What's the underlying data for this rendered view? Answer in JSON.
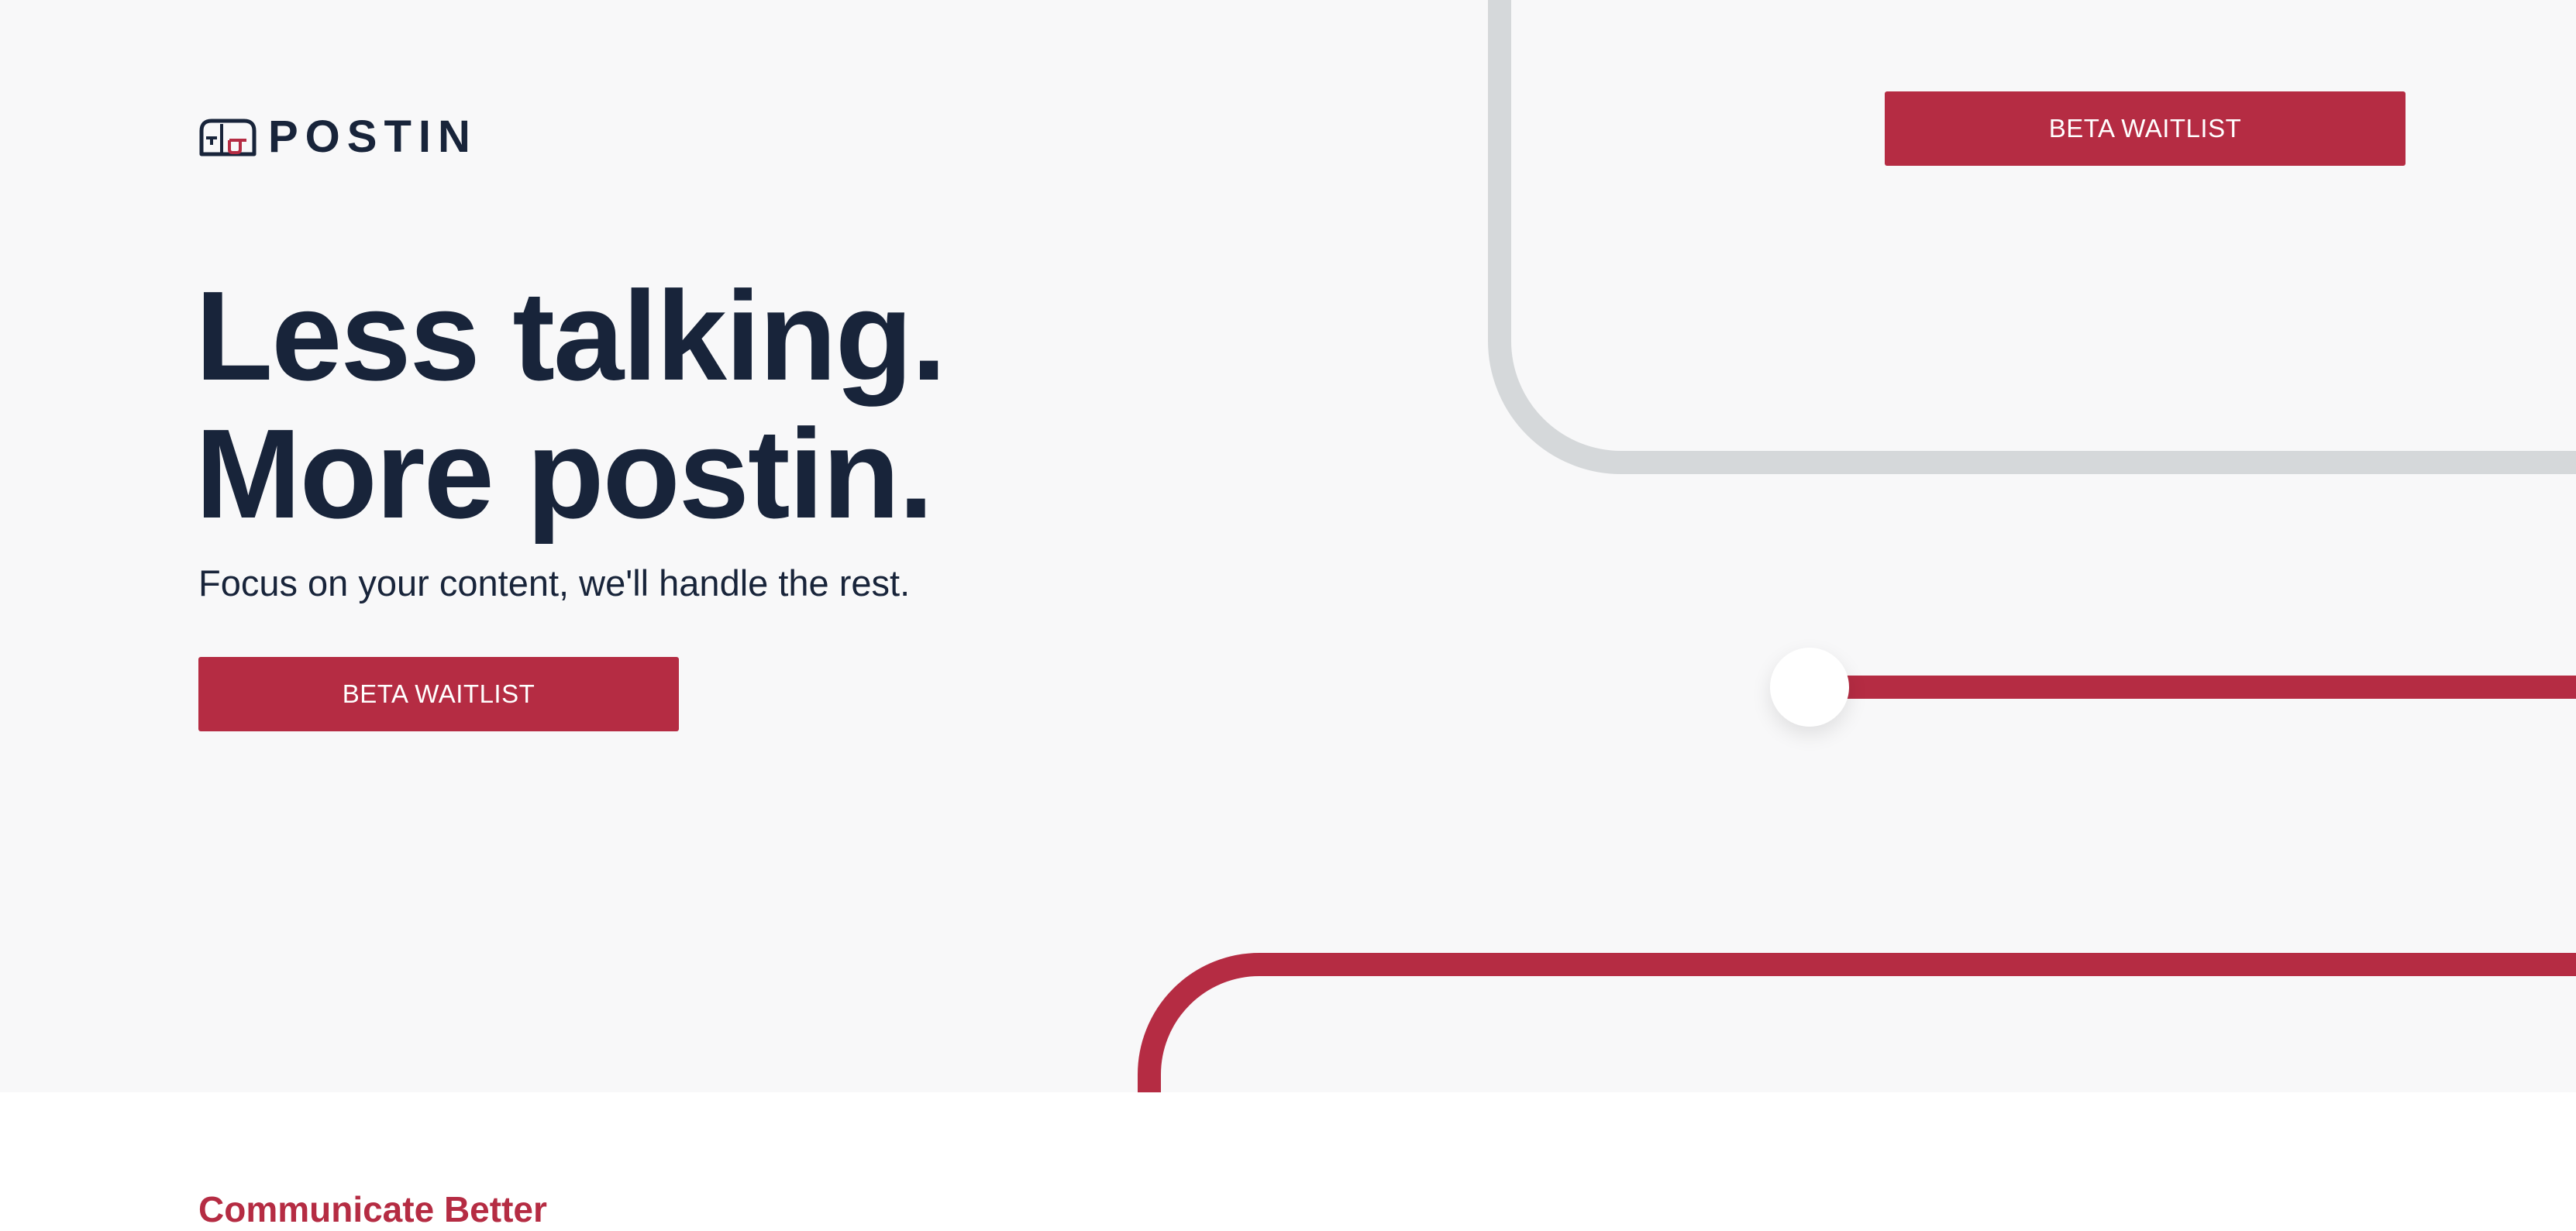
{
  "brand": {
    "name": "POSTIN",
    "logo_icon": "mailbox-icon"
  },
  "nav": {
    "cta_label": "BETA WAITLIST"
  },
  "hero": {
    "headline_line1": "Less talking.",
    "headline_line2": "More postin.",
    "subheadline": "Focus on your content, we'll handle the rest.",
    "cta_label": "BETA WAITLIST"
  },
  "next_section": {
    "label": "Communicate Better"
  },
  "colors": {
    "accent": "#b52c43",
    "navy": "#18243a",
    "hero_background": "#f8f8f9",
    "line_gray": "#d5d8da"
  }
}
